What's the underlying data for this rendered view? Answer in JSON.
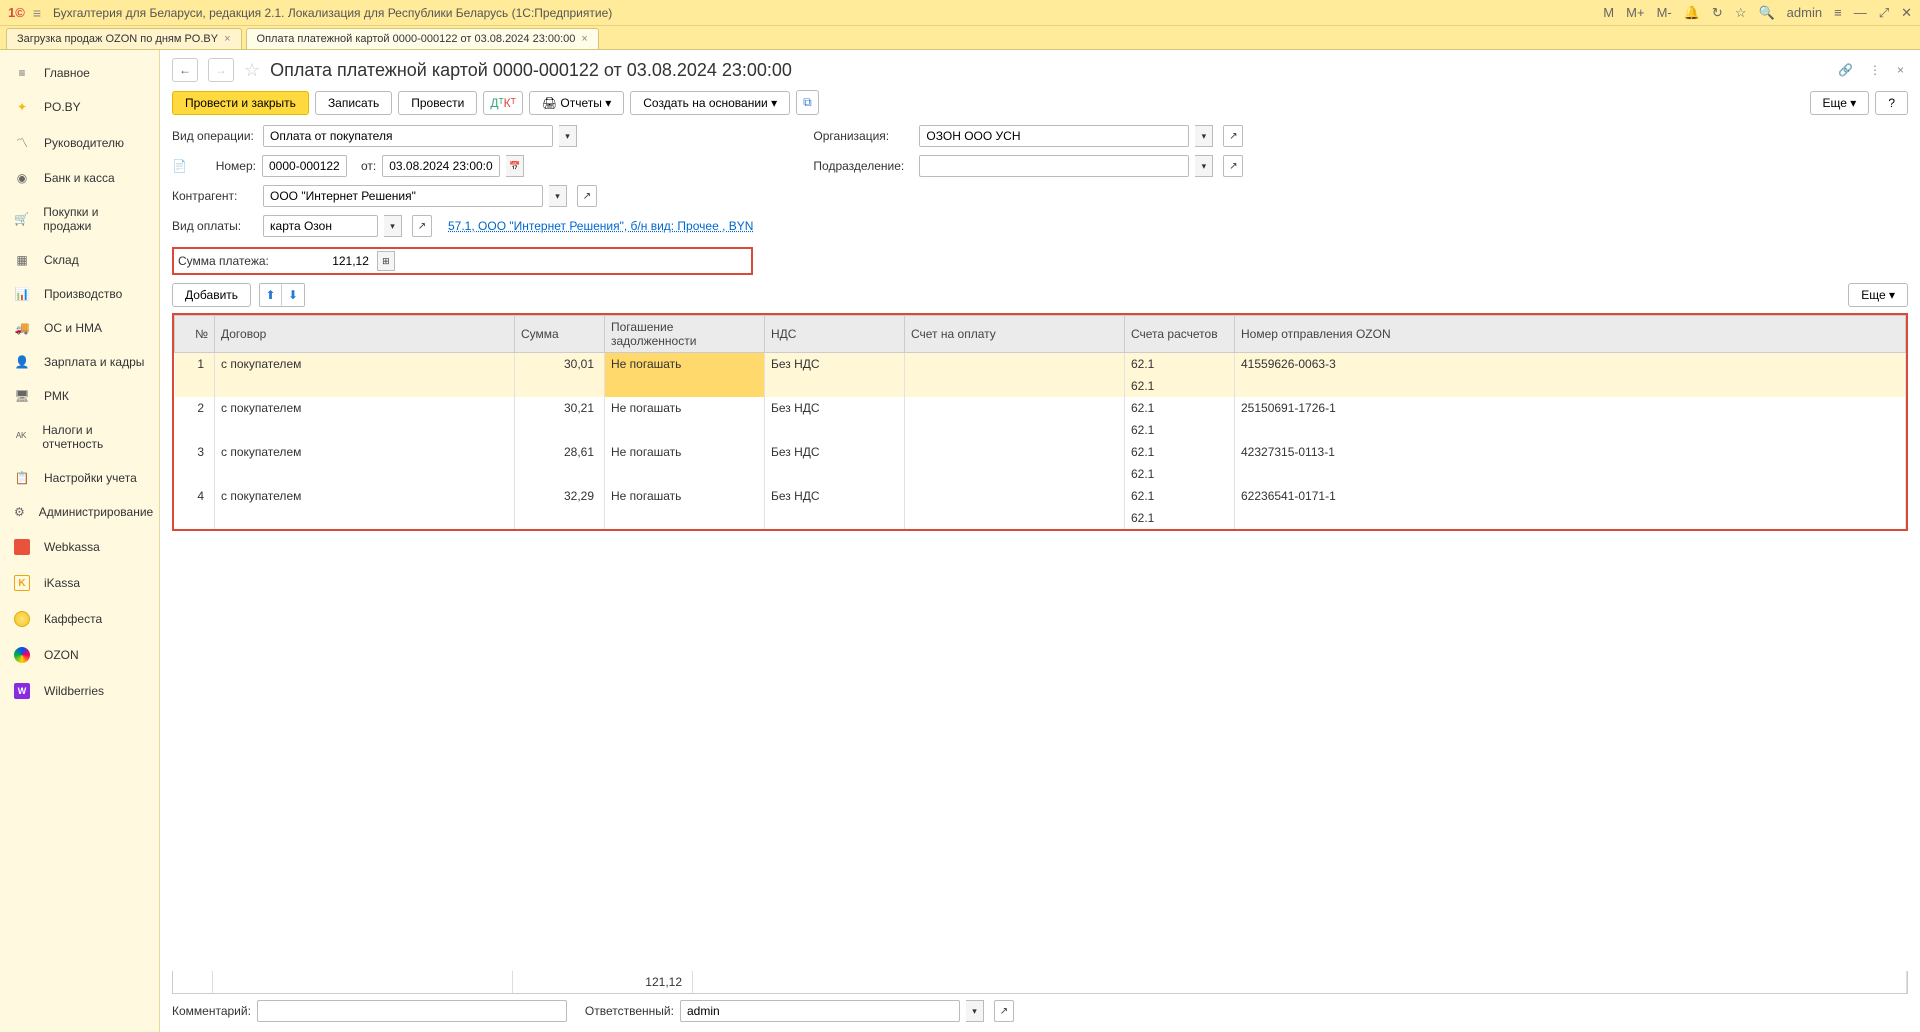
{
  "titlebar": {
    "app": "Бухгалтерия для Беларуси, редакция 2.1. Локализация для Республики Беларусь  (1С:Предприятие)",
    "user": "admin",
    "m": "M",
    "mplus": "M+",
    "mminus": "M-"
  },
  "tabs": [
    {
      "label": "Загрузка продаж OZON по дням PO.BY",
      "active": false
    },
    {
      "label": "Оплата платежной картой 0000-000122 от 03.08.2024 23:00:00",
      "active": true
    }
  ],
  "sidebar": [
    {
      "label": "Главное",
      "icon": "≡"
    },
    {
      "label": "PO.BY",
      "icon": "✦",
      "cls": "yellow"
    },
    {
      "label": "Руководителю",
      "icon": "〽"
    },
    {
      "label": "Банк и касса",
      "icon": "◉"
    },
    {
      "label": "Покупки и продажи",
      "icon": "🛒"
    },
    {
      "label": "Склад",
      "icon": "▦"
    },
    {
      "label": "Производство",
      "icon": "📊"
    },
    {
      "label": "ОС и НМА",
      "icon": "🚚"
    },
    {
      "label": "Зарплата и кадры",
      "icon": "👤"
    },
    {
      "label": "РМК",
      "icon": "🖥"
    },
    {
      "label": "Налоги и отчетность",
      "icon": "ᴬᴷ"
    },
    {
      "label": "Настройки учета",
      "icon": "📋"
    },
    {
      "label": "Администрирование",
      "icon": "⚙"
    },
    {
      "label": "Webkassa",
      "icon": "webkassa"
    },
    {
      "label": "iKassa",
      "icon": "ikassa"
    },
    {
      "label": "Каффеста",
      "icon": "kaffesta"
    },
    {
      "label": "OZON",
      "icon": "ozon"
    },
    {
      "label": "Wildberries",
      "icon": "wb"
    }
  ],
  "doc": {
    "title": "Оплата платежной картой 0000-000122 от 03.08.2024 23:00:00"
  },
  "toolbar": {
    "post_close": "Провести и закрыть",
    "write": "Записать",
    "post": "Провести",
    "reports": "Отчеты",
    "create_based": "Создать на основании",
    "more": "Еще",
    "help": "?"
  },
  "form": {
    "op_label": "Вид операции:",
    "op_value": "Оплата от покупателя",
    "num_label": "Номер:",
    "num_value": "0000-000122",
    "date_label": "от:",
    "date_value": "03.08.2024 23:00:00",
    "org_label": "Организация:",
    "org_value": "ОЗОН ООО УСН",
    "dept_label": "Подразделение:",
    "dept_value": "",
    "contr_label": "Контрагент:",
    "contr_value": "ООО \"Интернет Решения\"",
    "paytype_label": "Вид оплаты:",
    "paytype_value": "карта Озон",
    "paytype_link": "57.1, ООО \"Интернет Решения\", б/н вид: Прочее , BYN",
    "sum_label": "Сумма платежа:",
    "sum_value": "121,12"
  },
  "table_toolbar": {
    "add": "Добавить",
    "more": "Еще"
  },
  "columns": {
    "n": "№",
    "dog": "Договор",
    "sum": "Сумма",
    "pogash": "Погашение задолженности",
    "nds": "НДС",
    "schet": "Счет на оплату",
    "accounts": "Счета расчетов",
    "shipment": "Номер отправления OZON"
  },
  "rows": [
    {
      "n": "1",
      "dog": "с покупателем",
      "sum": "30,01",
      "pogash": "Не погашать",
      "nds": "Без НДС",
      "schet": "",
      "acc1": "62.1",
      "acc2": "62.1",
      "ship": "41559626-0063-3",
      "sel": true,
      "hl": true
    },
    {
      "n": "2",
      "dog": "с покупателем",
      "sum": "30,21",
      "pogash": "Не погашать",
      "nds": "Без НДС",
      "schet": "",
      "acc1": "62.1",
      "acc2": "62.1",
      "ship": "25150691-1726-1"
    },
    {
      "n": "3",
      "dog": "с покупателем",
      "sum": "28,61",
      "pogash": "Не погашать",
      "nds": "Без НДС",
      "schet": "",
      "acc1": "62.1",
      "acc2": "62.1",
      "ship": "42327315-0113-1"
    },
    {
      "n": "4",
      "dog": "с покупателем",
      "sum": "32,29",
      "pogash": "Не погашать",
      "nds": "Без НДС",
      "schet": "",
      "acc1": "62.1",
      "acc2": "62.1",
      "ship": "62236541-0171-1"
    }
  ],
  "totals": {
    "sum": "121,12"
  },
  "footer": {
    "comment_label": "Комментарий:",
    "comment_value": "",
    "resp_label": "Ответственный:",
    "resp_value": "admin"
  }
}
